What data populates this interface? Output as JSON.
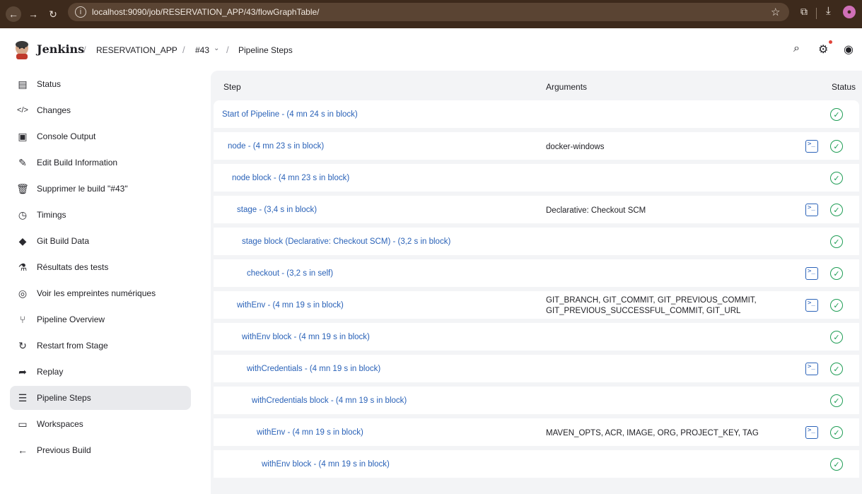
{
  "browser": {
    "url": "localhost:9090/job/RESERVATION_APP/43/flowGraphTable/",
    "back_icon": "arrow-left-icon",
    "forward_icon": "arrow-right-icon",
    "reload_icon": "reload-icon"
  },
  "header": {
    "brand": "Jenkins",
    "breadcrumbs": [
      "RESERVATION_APP",
      "#43",
      "Pipeline Steps"
    ]
  },
  "sidebar": {
    "items": [
      {
        "label": "Status",
        "icon": "document-icon"
      },
      {
        "label": "Changes",
        "icon": "code-icon"
      },
      {
        "label": "Console Output",
        "icon": "terminal-icon"
      },
      {
        "label": "Edit Build Information",
        "icon": "edit-icon"
      },
      {
        "label": "Supprimer le build \"#43\"",
        "icon": "trash-icon"
      },
      {
        "label": "Timings",
        "icon": "clock-icon"
      },
      {
        "label": "Git Build Data",
        "icon": "git-icon"
      },
      {
        "label": "Résultats des tests",
        "icon": "flask-icon"
      },
      {
        "label": "Voir les empreintes numériques",
        "icon": "fingerprint-icon"
      },
      {
        "label": "Pipeline Overview",
        "icon": "pipeline-icon"
      },
      {
        "label": "Restart from Stage",
        "icon": "restart-icon"
      },
      {
        "label": "Replay",
        "icon": "replay-icon"
      },
      {
        "label": "Pipeline Steps",
        "icon": "list-icon",
        "active": true
      },
      {
        "label": "Workspaces",
        "icon": "folder-icon"
      },
      {
        "label": "Previous Build",
        "icon": "arrow-left-icon"
      }
    ]
  },
  "table": {
    "headers": {
      "step": "Step",
      "arguments": "Arguments",
      "status": "Status"
    },
    "rows": [
      {
        "step": "Start of Pipeline - (4 mn 24 s in block)",
        "args": "",
        "console": false
      },
      {
        "step": "node - (4 mn 23 s in block)",
        "args": "docker-windows",
        "console": true
      },
      {
        "step": "node block - (4 mn 23 s in block)",
        "args": "",
        "console": false
      },
      {
        "step": "stage - (3,4 s in block)",
        "args": "Declarative: Checkout SCM",
        "console": true
      },
      {
        "step": "stage block (Declarative: Checkout SCM) - (3,2 s in block)",
        "args": "",
        "console": false
      },
      {
        "step": "checkout - (3,2 s in self)",
        "args": "",
        "console": true
      },
      {
        "step": "withEnv - (4 mn 19 s in block)",
        "args": "GIT_BRANCH, GIT_COMMIT, GIT_PREVIOUS_COMMIT, GIT_PREVIOUS_SUCCESSFUL_COMMIT, GIT_URL",
        "console": true
      },
      {
        "step": "withEnv block - (4 mn 19 s in block)",
        "args": "",
        "console": false
      },
      {
        "step": "withCredentials - (4 mn 19 s in block)",
        "args": "",
        "console": true
      },
      {
        "step": "withCredentials block - (4 mn 19 s in block)",
        "args": "",
        "console": false
      },
      {
        "step": "withEnv - (4 mn 19 s in block)",
        "args": "MAVEN_OPTS, ACR, IMAGE, ORG, PROJECT_KEY, TAG",
        "console": true
      },
      {
        "step": "withEnv block - (4 mn 19 s in block)",
        "args": "",
        "console": false
      }
    ]
  },
  "colors": {
    "link": "#2a62b8",
    "success": "#1f9d55",
    "browser_bar": "#3d2a1c"
  }
}
